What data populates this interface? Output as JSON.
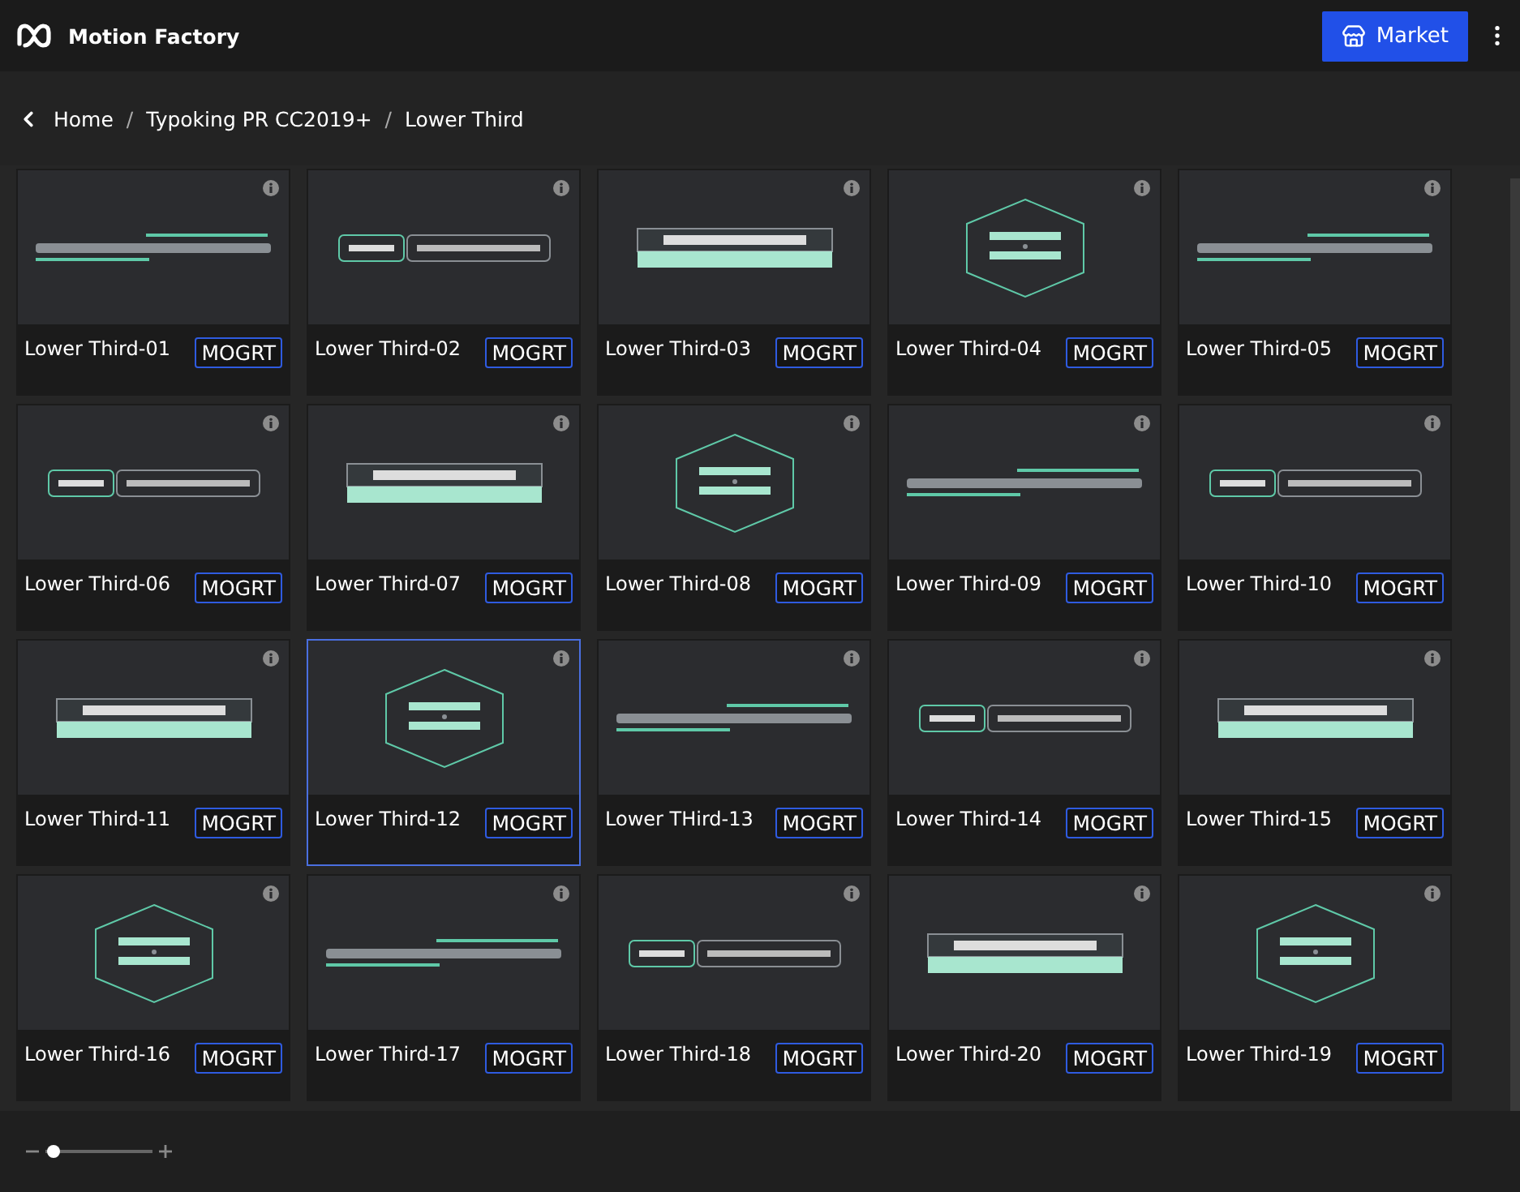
{
  "app": {
    "title": "Motion Factory"
  },
  "header": {
    "market_button": "Market"
  },
  "breadcrumb": {
    "separator": "/",
    "items": [
      "Home",
      "Typoking PR CC2019+",
      "Lower Third"
    ]
  },
  "cards": [
    {
      "name": "Lower Third-01",
      "format": "MOGRT",
      "selected": false
    },
    {
      "name": "Lower Third-02",
      "format": "MOGRT",
      "selected": false
    },
    {
      "name": "Lower Third-03",
      "format": "MOGRT",
      "selected": false
    },
    {
      "name": "Lower Third-04",
      "format": "MOGRT",
      "selected": false
    },
    {
      "name": "Lower Third-05",
      "format": "MOGRT",
      "selected": false
    },
    {
      "name": "Lower Third-06",
      "format": "MOGRT",
      "selected": false
    },
    {
      "name": "Lower Third-07",
      "format": "MOGRT",
      "selected": false
    },
    {
      "name": "Lower Third-08",
      "format": "MOGRT",
      "selected": false
    },
    {
      "name": "Lower Third-09",
      "format": "MOGRT",
      "selected": false
    },
    {
      "name": "Lower Third-10",
      "format": "MOGRT",
      "selected": false
    },
    {
      "name": "Lower Third-11",
      "format": "MOGRT",
      "selected": false
    },
    {
      "name": "Lower Third-12",
      "format": "MOGRT",
      "selected": true
    },
    {
      "name": "Lower THird-13",
      "format": "MOGRT",
      "selected": false
    },
    {
      "name": "Lower Third-14",
      "format": "MOGRT",
      "selected": false
    },
    {
      "name": "Lower Third-15",
      "format": "MOGRT",
      "selected": false
    },
    {
      "name": "Lower Third-16",
      "format": "MOGRT",
      "selected": false
    },
    {
      "name": "Lower Third-17",
      "format": "MOGRT",
      "selected": false
    },
    {
      "name": "Lower Third-18",
      "format": "MOGRT",
      "selected": false
    },
    {
      "name": "Lower Third-20",
      "format": "MOGRT",
      "selected": false
    },
    {
      "name": "Lower Third-19",
      "format": "MOGRT",
      "selected": false
    }
  ],
  "zoom_slider": {
    "level": 0.07
  }
}
